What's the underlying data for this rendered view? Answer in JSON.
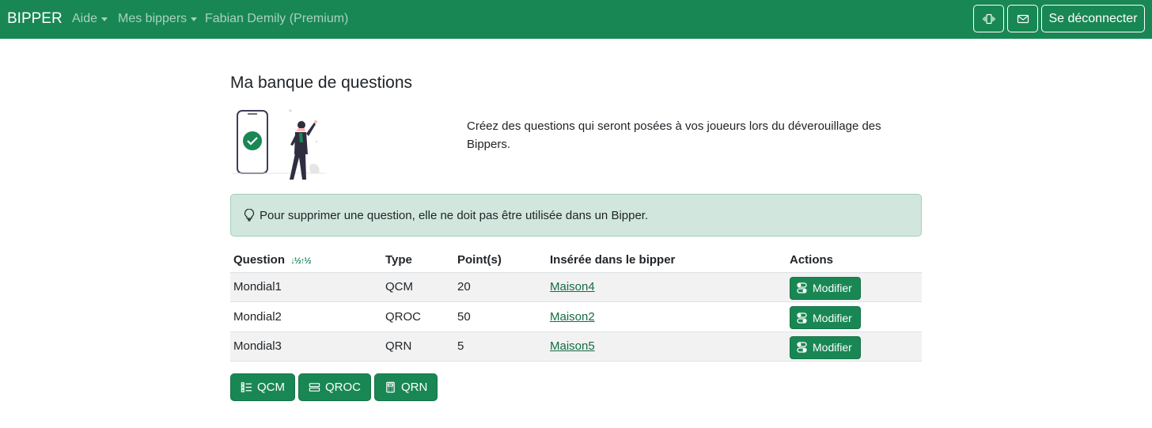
{
  "navbar": {
    "brand": "BIPPER",
    "aide": "Aide",
    "mes_bippers": "Mes bippers",
    "user": "Fabian Demily (Premium)",
    "vibrate_icon": "vibrate-icon",
    "mail_icon": "envelope-icon",
    "logout": "Se déconnecter"
  },
  "main": {
    "title": "Ma banque de questions",
    "intro": "Créez des questions qui seront posées à vos joueurs lors du déverouillage des Bippers.",
    "alert": "Pour supprimer une question, elle ne doit pas être utilisée dans un Bipper."
  },
  "table": {
    "headers": {
      "question": "Question",
      "type": "Type",
      "points": "Point(s)",
      "bipper": "Insérée dans le bipper",
      "actions": "Actions"
    },
    "rows": [
      {
        "question": "Mondial1",
        "type": "QCM",
        "points": "20",
        "bipper": "Maison4",
        "action": "Modifier"
      },
      {
        "question": "Mondial2",
        "type": "QROC",
        "points": "50",
        "bipper": "Maison2",
        "action": "Modifier"
      },
      {
        "question": "Mondial3",
        "type": "QRN",
        "points": "5",
        "bipper": "Maison5",
        "action": "Modifier"
      }
    ]
  },
  "buttons": {
    "qcm": "QCM",
    "qroc": "QROC",
    "qrn": "QRN"
  },
  "colors": {
    "primary": "#198754",
    "alert_bg": "#d1e7dd",
    "link": "#146c43"
  }
}
